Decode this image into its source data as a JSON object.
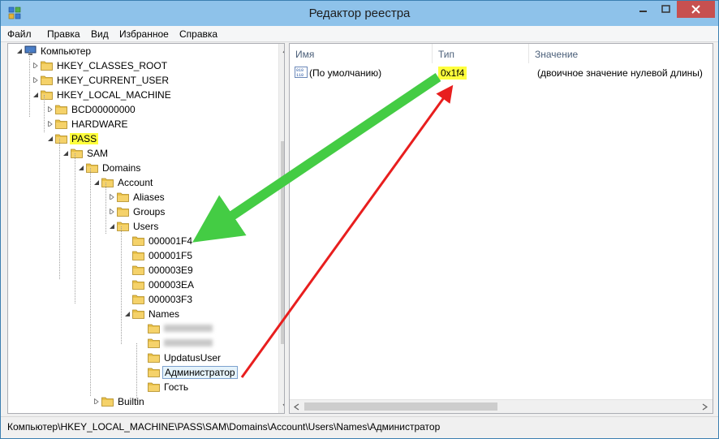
{
  "window": {
    "title": "Редактор реестра"
  },
  "menu": [
    "Файл",
    "Правка",
    "Вид",
    "Избранное",
    "Справка"
  ],
  "tree": [
    {
      "label": "Компьютер",
      "icon": "computer-icon",
      "exp": "expanded"
    },
    {
      "label": "HKEY_CLASSES_ROOT",
      "icon": "folder-icon",
      "exp": "collapsed"
    },
    {
      "label": "HKEY_CURRENT_USER",
      "icon": "folder-icon",
      "exp": "collapsed"
    },
    {
      "label": "HKEY_LOCAL_MACHINE",
      "icon": "folder-icon",
      "exp": "expanded"
    },
    {
      "label": "BCD00000000",
      "icon": "folder-icon",
      "exp": "collapsed"
    },
    {
      "label": "HARDWARE",
      "icon": "folder-icon",
      "exp": "collapsed"
    },
    {
      "label": "PASS",
      "icon": "folder-icon",
      "exp": "expanded",
      "highlight": true
    },
    {
      "label": "SAM",
      "icon": "folder-icon",
      "exp": "expanded"
    },
    {
      "label": "Domains",
      "icon": "folder-icon",
      "exp": "expanded"
    },
    {
      "label": "Account",
      "icon": "folder-icon",
      "exp": "expanded"
    },
    {
      "label": "Aliases",
      "icon": "folder-icon",
      "exp": "collapsed"
    },
    {
      "label": "Groups",
      "icon": "folder-icon",
      "exp": "collapsed"
    },
    {
      "label": "Users",
      "icon": "folder-icon",
      "exp": "expanded"
    },
    {
      "label": "000001F4",
      "icon": "folder-icon",
      "exp": "none"
    },
    {
      "label": "000001F5",
      "icon": "folder-icon",
      "exp": "none"
    },
    {
      "label": "000003E9",
      "icon": "folder-icon",
      "exp": "none"
    },
    {
      "label": "000003EA",
      "icon": "folder-icon",
      "exp": "none"
    },
    {
      "label": "000003F3",
      "icon": "folder-icon",
      "exp": "none"
    },
    {
      "label": "Names",
      "icon": "folder-icon",
      "exp": "expanded"
    },
    {
      "label": "",
      "icon": "folder-icon",
      "exp": "none",
      "blurred": true
    },
    {
      "label": "",
      "icon": "folder-icon",
      "exp": "none",
      "blurred": true
    },
    {
      "label": "UpdatusUser",
      "icon": "folder-icon",
      "exp": "none"
    },
    {
      "label": "Администратор",
      "icon": "folder-open-icon",
      "exp": "none",
      "selected": true
    },
    {
      "label": "Гость",
      "icon": "folder-icon",
      "exp": "none"
    },
    {
      "label": "Builtin",
      "icon": "folder-icon",
      "exp": "collapsed"
    }
  ],
  "list": {
    "columns": [
      "Имя",
      "Тип",
      "Значение"
    ],
    "rows": [
      {
        "name": "(По умолчанию)",
        "type": "0x1f4",
        "value": "(двоичное значение нулевой длины)",
        "icon": "binary-value-icon"
      }
    ]
  },
  "status": {
    "path": "Компьютер\\HKEY_LOCAL_MACHINE\\PASS\\SAM\\Domains\\Account\\Users\\Names\\Администратор"
  },
  "colors": {
    "titlebar": "#8ec2ea",
    "close_button": "#c75050",
    "highlight_yellow": "#ffff3c",
    "green_arrow": "#44cc44",
    "red_arrow": "#e81e1e",
    "folder": "#e8c048"
  }
}
